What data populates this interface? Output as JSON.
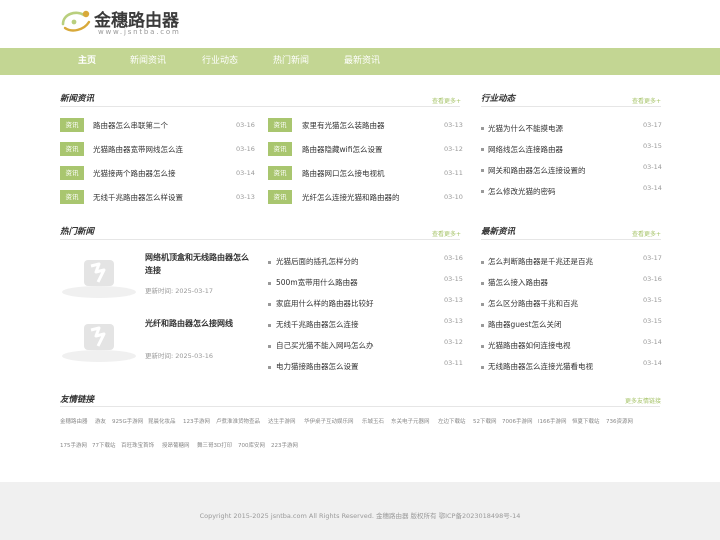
{
  "logo": {
    "name": "金穗路由器",
    "url": "www.jsntba.com",
    "brand_color": "#a9c66f"
  },
  "nav": {
    "bg_color": "#c3d693",
    "items": [
      {
        "label": "主页",
        "active": true
      },
      {
        "label": "新闻资讯",
        "active": false
      },
      {
        "label": "行业动态",
        "active": false
      },
      {
        "label": "热门新闻",
        "active": false
      },
      {
        "label": "最新资讯",
        "active": false
      }
    ]
  },
  "news": {
    "title": "新闻资讯",
    "more": "查看更多+",
    "badge": "资讯",
    "left": [
      {
        "title": "路由器怎么串联第二个",
        "date": "03-16"
      },
      {
        "title": "光猫路由器宽带网线怎么连",
        "date": "03-16"
      },
      {
        "title": "光猫接两个路由器怎么接",
        "date": "03-14"
      },
      {
        "title": "无线千兆路由器怎么样设置",
        "date": "03-13"
      }
    ],
    "right": [
      {
        "title": "家里有光猫怎么装路由器",
        "date": "03-13"
      },
      {
        "title": "路由器隐藏wifi怎么设置",
        "date": "03-12"
      },
      {
        "title": "路由器网口怎么接电视机",
        "date": "03-11"
      },
      {
        "title": "光纤怎么连接光猫和路由器的",
        "date": "03-10"
      }
    ]
  },
  "industry": {
    "title": "行业动态",
    "more": "查看更多+",
    "items": [
      {
        "title": "光猫为什么不能摸电源",
        "date": "03-17"
      },
      {
        "title": "网络线怎么连接路由器",
        "date": "03-15"
      },
      {
        "title": "网关和路由器怎么连接设置的",
        "date": "03-14"
      },
      {
        "title": "怎么修改光猫的密码",
        "date": "03-14"
      }
    ]
  },
  "hot": {
    "title": "热门新闻",
    "more": "查看更多+",
    "featured": [
      {
        "title": "网络机顶盒和无线路由器怎么连接",
        "time": "更新时间: 2025-03-17"
      },
      {
        "title": "光纤和路由器怎么接网线",
        "time": "更新时间: 2025-03-16"
      }
    ],
    "list": [
      {
        "title": "光猫后面的插孔怎样分的",
        "date": "03-16"
      },
      {
        "title": "500m宽带用什么路由器",
        "date": "03-15"
      },
      {
        "title": "家庭用什么样的路由器比较好",
        "date": "03-13"
      },
      {
        "title": "无线千兆路由器怎么连接",
        "date": "03-13"
      },
      {
        "title": "自己买光猫不能入网吗怎么办",
        "date": "03-12"
      },
      {
        "title": "电力猫接路由器怎么设置",
        "date": "03-11"
      }
    ]
  },
  "latest": {
    "title": "最新资讯",
    "more": "查看更多+",
    "items": [
      {
        "title": "怎么判断路由器是千兆还是百兆",
        "date": "03-17"
      },
      {
        "title": "猫怎么接入路由器",
        "date": "03-16"
      },
      {
        "title": "怎么区分路由器千兆和百兆",
        "date": "03-15"
      },
      {
        "title": "路由器guest怎么关闭",
        "date": "03-15"
      },
      {
        "title": "光猫路由器如何连接电视",
        "date": "03-14"
      },
      {
        "title": "无线路由器怎么连接光猫看电视",
        "date": "03-14"
      }
    ]
  },
  "friends": {
    "title": "友情链接",
    "more": "更多友情链接",
    "row1": [
      "金穗路由器",
      "游友",
      "925G手游网",
      "昆晨化妆品",
      "123手游网",
      "卢煮淮淮货物查品",
      "达生手游网",
      "华伊桌子互动娱乐网",
      "乐城玉石",
      "东关电子元器网",
      "左边下载站",
      "52下载网",
      "7006手游网",
      "l166手游网",
      "恒夏下载站",
      "736资源网"
    ],
    "row2": [
      "175手游网",
      "77下载站",
      "百旺珠宝首饰",
      "授昂葡糖网",
      "舞三哥3D打印",
      "700库安网",
      "223手游网"
    ]
  },
  "footer": {
    "text": "Copyright 2015-2025 jsntba.com All Rights Reserved. 金穗路由器 版权所有 鄂ICP备2023018498号-14"
  }
}
